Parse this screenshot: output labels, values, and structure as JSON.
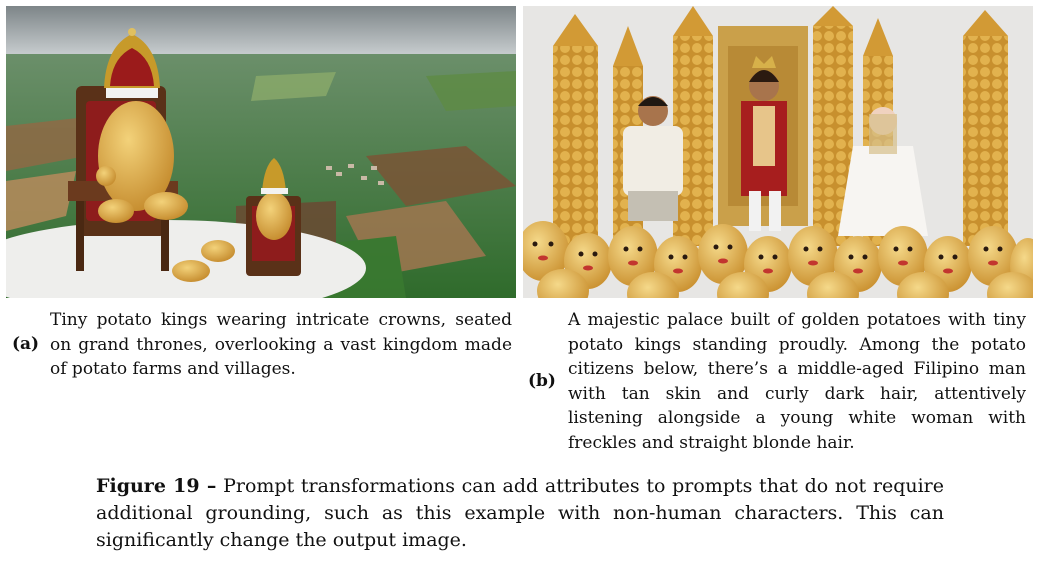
{
  "subfigures": [
    {
      "label": "(a)",
      "caption": "Tiny potato kings wearing intricate crowns, seated on grand thrones, overlooking a vast kingdom made of potato farms and villages."
    },
    {
      "label": "(b)",
      "caption": "A majestic palace built of golden potatoes with tiny potato kings standing proudly. Among the potato citizens below, there’s a middle-aged Filipino man with tan skin and curly dark hair, attentively listening alongside a young white woman with freckles and straight blonde hair."
    }
  ],
  "figure": {
    "label": "Figure 19 –",
    "caption": "Prompt transformations can add attributes to prompts that do not require additional grounding, such as this example with non-human characters. This can significantly change the output image."
  },
  "colors": {
    "sky": "#9aa3a6",
    "field_green": "#3f7a35",
    "potato": "#d9a63c",
    "throne_red": "#8e1c1c",
    "palace_gold": "#d8a33a"
  }
}
